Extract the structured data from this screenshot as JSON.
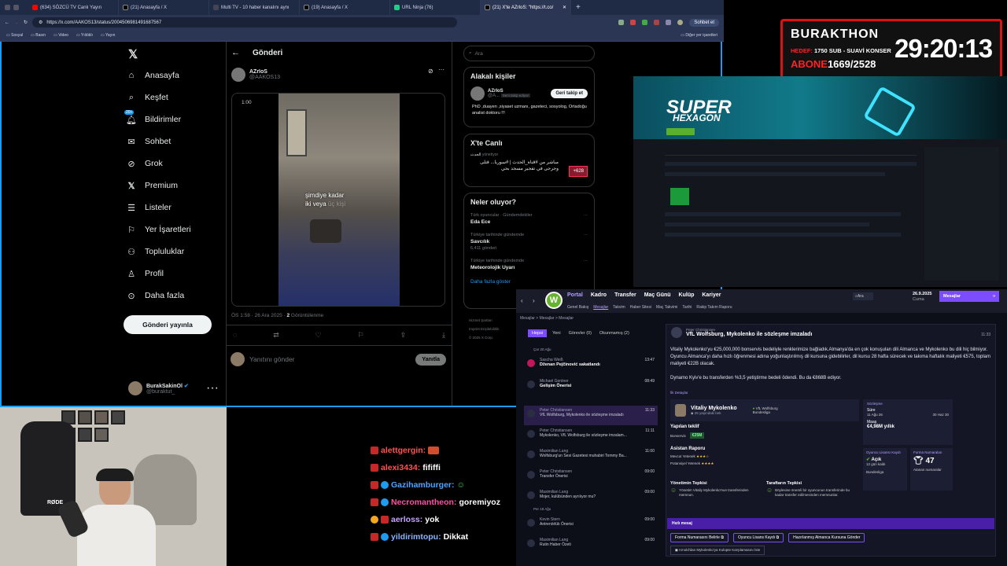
{
  "browser": {
    "tabs": [
      "(634) SÖZCÜ TV Canlı Yayın",
      "(21) Anasayfa / X",
      "Multi TV - 10 haber kanalını aynı",
      "(19) Anasayfa / X",
      "URL Ninja (76)",
      "(21) X'te AZrIoS: \"https://t.co/"
    ],
    "url": "https://x.com/AAKOS13/status/2004506981491687567",
    "chat_label": "Sohbet et",
    "bookmarks": [
      "Sosyal",
      "Basın",
      "Video",
      "Yıldıklı",
      "Yayın"
    ],
    "other_bookmarks": "Diğer yer işaretleri"
  },
  "x": {
    "nav": [
      "Anasayfa",
      "Keşfet",
      "Bildirimler",
      "Sohbet",
      "Grok",
      "Premium",
      "Listeler",
      "Yer İşaretleri",
      "Topluluklar",
      "Profil",
      "Daha fazla"
    ],
    "notif_badge": "20+",
    "post_button": "Gönderi yayınla",
    "account_name": "BurakSakinOl",
    "account_handle": "@buraktut_",
    "header_title": "Gönderi",
    "author_name": "AZrIoS",
    "author_handle": "@AAKOS13",
    "video_time": "1:00",
    "subtitle_line1": "şimdiye kadar",
    "subtitle_line2": "iki veya",
    "subtitle_faded": "üç kişi",
    "post_meta": "ÖS 1:58 · 26 Ara 2025 · ",
    "views_count": "2",
    "views_label": "Görüntülenme",
    "reply_placeholder": "Yanıtını gönder",
    "reply_button": "Yanıtla",
    "search_placeholder": "Ara",
    "related_title": "Alakalı kişiler",
    "related_name": "AZrIoS",
    "related_handle": "@A...",
    "related_follows": "Seni takip ediyor",
    "related_button": "Geri takip et",
    "related_bio": "PhD ,duayen ,siyaset uzmanı, gazeteci, sosyolog, Ortadoğu analist doktoru !!!",
    "live_title": "X'te Canlı",
    "live_host": "الحدث",
    "live_role": "yönetiyor",
    "live_text": "مباشر من #قناة_الحدث | #سوريا... قتلى وجرحى في تفجير مسجد بحي",
    "live_count": "+628",
    "trends_title": "Neler oluyor?",
    "trends": [
      {
        "ctx": "Türk oyuncular · Gündemdekiler",
        "name": "Eda Ece",
        "count": ""
      },
      {
        "ctx": "Türkiye tarihinde gündemde",
        "name": "Savcılık",
        "count": "6.411 gönderi"
      },
      {
        "ctx": "Türkiye tarihinde gündemde",
        "name": "Meteorolojik Uyarı",
        "count": ""
      }
    ],
    "show_more": "Daha fazla göster",
    "footer": [
      "Hizmet Şartları",
      "Gizlilik Politikası",
      "Çerez Politikası",
      "Erişilebilirlik",
      "Reklam bilgisi",
      "Daha fazla",
      "Imprint",
      "© 2025 X Corp."
    ]
  },
  "stream": {
    "timer_name": "BURAKTHON",
    "timer_goal_label": "HEDEF:",
    "timer_goal": "1750 SUB - SUAVİ KONSER",
    "timer_sub_label": "ABONE",
    "timer_subs": "1669/2528",
    "timer_value": "29:20:13",
    "game_title_1": "SUPER",
    "game_title_2": "HEXAGON",
    "chat": [
      {
        "user": "alettgergin:",
        "msg": ""
      },
      {
        "user": "alexi3434:",
        "msg": "fififfi"
      },
      {
        "user": "Gazihamburger:",
        "msg": ""
      },
      {
        "user": "Necromantheon:",
        "msg": "goremiyoz"
      },
      {
        "user": "aerloss:",
        "msg": "yok"
      },
      {
        "user": "yildirimtopu:",
        "msg": "Dikkat"
      }
    ],
    "mic_label": "RØDE"
  },
  "fm": {
    "menu": [
      "Portal",
      "Kadro",
      "Transfer",
      "Maç Günü",
      "Kulüp",
      "Kariyer"
    ],
    "submenu": [
      "Genel Bakış",
      "Mesajlar",
      "Takvim",
      "Haber Sitesi",
      "Maç Takvimi",
      "Tarihi",
      "Rakip Takım Raporu"
    ],
    "search": "Ara",
    "date": "26.9.2025",
    "day": "Cuma",
    "message_btn": "Mesajlar",
    "breadcrumb": "Mesajlar > Mesajlar > Mesajlar",
    "filters": [
      "Hepsi",
      "Yeni",
      "Görevler (0)",
      "Okunmamış (2)"
    ],
    "date_group": "Çar 20 Ağu",
    "date_group2": "Per 18 Ağu",
    "messages": [
      {
        "from": "Sascha Weiß",
        "subject": "Dženan Pejčinović sakatlandı",
        "time": "13:47"
      },
      {
        "from": "Michael Gentner",
        "subject": "Gelişim Önerisi",
        "time": "08:49"
      },
      {
        "from": "Peter Christiansen",
        "subject": "VfL Wolfsburg, Mykolenko ile sözleşme imzaladı",
        "time": "11:33"
      },
      {
        "from": "Peter Christiansen",
        "subject": "Mykolenko, VfL Wolfsburg ile sözleşme imzalam...",
        "time": "11:11"
      },
      {
        "from": "Maximilian Lang",
        "subject": "Wolfsburg'un Sesi Gazetesi muhabiri Tommy Ba...",
        "time": "11:00"
      },
      {
        "from": "Peter Christiansen",
        "subject": "Transfer Önerisi",
        "time": "09:00"
      },
      {
        "from": "Maximilian Lang",
        "subject": "Mojer, kulübünden ayrılıyor mu?",
        "time": "09:00"
      },
      {
        "from": "Kevin Stern",
        "subject": "Antrenörlük Önerisi",
        "time": "09:00"
      },
      {
        "from": "Maximilian Lang",
        "subject": "Rutin Haber Özeti",
        "time": "09:00"
      }
    ],
    "detail_from": "Peter Christiansen",
    "detail_title": "VfL Wolfsburg, Mykolenko ile sözleşme imzaladı",
    "detail_time": "11:33",
    "body1": "Vitaliy Mykolenko'yu €25,000,000 bonservis bedeliyle renklerimize bağladık.Almanya'da en çok konuşulan dili Almanca ve Mykolenko bu dili hiç bilmiyor. Oyuncu Almanca'yı daha hızlı öğrenmesi adına yoğunlaştırılmış dil kursuna gidebilirler, dil kursu 28 hafta sürecek ve takıma haftalık maliyeti €575, toplam maliyeti €22B olacak.",
    "body2": "Dynamo Kyiv'e bu transferden %3,5 yetiştirme bedeli ödendi. Bu da €868B ediyor.",
    "section_label": "İlk Detaylar",
    "player_name": "Vitaliy Mykolenko",
    "player_age": "26 yaşındaki bek",
    "player_club": "VfL Wolfsburg",
    "player_pos": "Bundesliga",
    "contract_label": "Sözleşme",
    "contract_dur": "Süre",
    "contract_from": "11 Ağu 26",
    "contract_to": "30 Haz 30",
    "wage_label": "Maaş",
    "wage": "€4,98M yıllık",
    "fee_label": "Yapılan teklif",
    "fee_sub": "Bonservis",
    "fee": "€25M",
    "scout_label": "Asistan Raporu",
    "scout_cur": "Mevcut Yetenek",
    "scout_pot": "Potansiyel Yetenek",
    "license_label": "Oyuncu Lisansı Kaydı",
    "license_val": "Açık",
    "license_sub": "12 gün kaldı",
    "license_league": "Bundesliga",
    "shirt_label": "Forma Numaraları",
    "shirt": "47",
    "shirt_sub": "Atanan numaralar",
    "reaction1_title": "Yönetimin Tepkisi",
    "reaction1": "Yönetim Vitaliy Mykolenko'nun transferinden memnun.",
    "reaction2_title": "Taraftarın Tepkisi",
    "reaction2": "Böylesine önemli bir oyuncunun transferinde bu kadar transfer edilmesinden memnunlar.",
    "quick_msg": "Hızlı mesaj",
    "actions": [
      "Forma Numarasını Belirle",
      "Oyuncu Lisans Kaydı",
      "Hazırlanmış Almanca Kursuna Gönder"
    ],
    "action_bottom": "Arnold'dan Mykolenko'ya Kulüpte Karşılamasını İste"
  },
  "colors": {
    "accent": "#1d9bf0",
    "fm_purple": "#7c4dff",
    "wolfsburg_green": "#65b32e",
    "timer_red": "#dd1111"
  }
}
